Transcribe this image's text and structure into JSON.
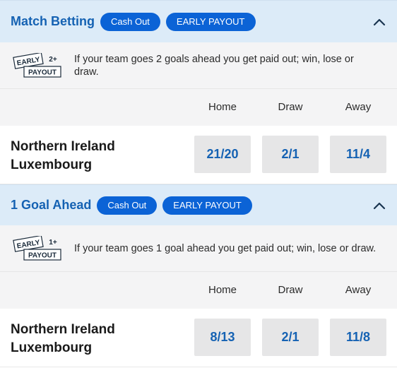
{
  "markets": [
    {
      "title": "Match Betting",
      "cash_out_label": "Cash Out",
      "early_payout_label": "EARLY PAYOUT",
      "badge": {
        "line1": "EARLY",
        "goals": "2+",
        "line2": "PAYOUT"
      },
      "promo_text": "If your team goes 2 goals ahead you get paid out; win, lose or draw.",
      "columns": [
        "Home",
        "Draw",
        "Away"
      ],
      "home_team": "Northern Ireland",
      "away_team": "Luxembourg",
      "odds": [
        "21/20",
        "2/1",
        "11/4"
      ]
    },
    {
      "title": "1 Goal Ahead",
      "cash_out_label": "Cash Out",
      "early_payout_label": "EARLY PAYOUT",
      "badge": {
        "line1": "EARLY",
        "goals": "1+",
        "line2": "PAYOUT"
      },
      "promo_text": "If your team goes 1 goal ahead you get paid out; win, lose or draw.",
      "columns": [
        "Home",
        "Draw",
        "Away"
      ],
      "home_team": "Northern Ireland",
      "away_team": "Luxembourg",
      "odds": [
        "8/13",
        "2/1",
        "11/8"
      ]
    }
  ],
  "icons": {
    "collapse": "chevron-up-icon"
  },
  "colors": {
    "accent": "#1562b3",
    "pill": "#0b63d6",
    "header_bg": "#dcebf8"
  }
}
